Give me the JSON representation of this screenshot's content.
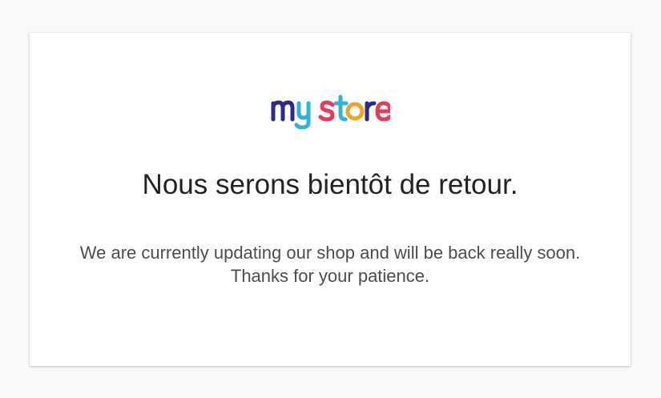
{
  "logo": {
    "alt": "my store",
    "colors": {
      "m": "#2a2a8f",
      "y": "#2fb3d6",
      "s": "#e63a57",
      "t": "#2fb3d6",
      "o": "#f0a520",
      "r": "#2a2a8f",
      "e": "#e63a57"
    }
  },
  "maintenance": {
    "headline": "Nous serons bientôt de retour.",
    "message_line1": "We are currently updating our shop and will be back really soon.",
    "message_line2": "Thanks for your patience."
  }
}
